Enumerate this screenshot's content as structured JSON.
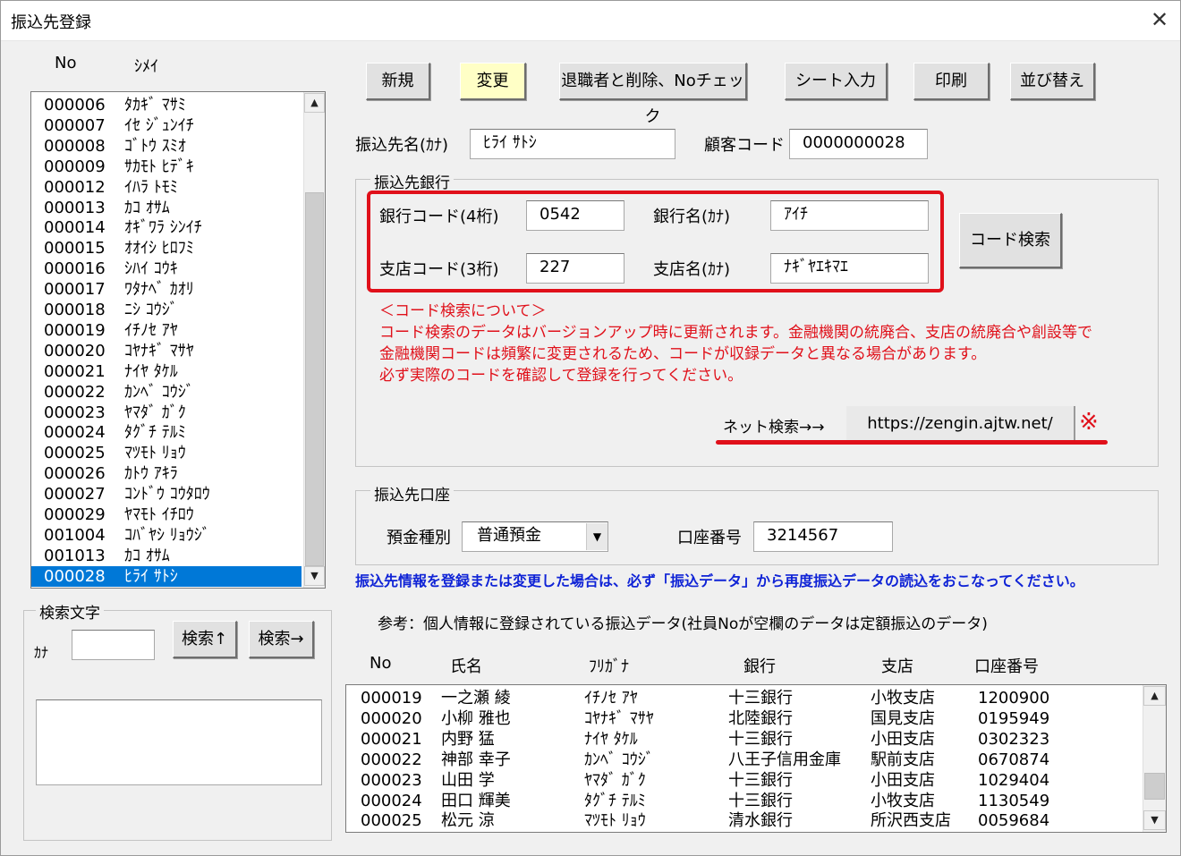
{
  "window": {
    "title": "振込先登録",
    "close_glyph": "✕"
  },
  "left_list": {
    "headers": {
      "no": "No",
      "name": "ｼﾒｲ"
    },
    "rows": [
      {
        "no": "000006",
        "name": "ﾀｶｷﾞ ﾏｻﾐ"
      },
      {
        "no": "000007",
        "name": "ｲｾ ｼﾞｭﾝｲﾁ"
      },
      {
        "no": "000008",
        "name": "ｺﾞﾄｳ ｽﾐｵ"
      },
      {
        "no": "000009",
        "name": "ｻｶﾓﾄ ﾋﾃﾞｷ"
      },
      {
        "no": "000012",
        "name": "ｲﾊﾗ ﾄﾓﾐ"
      },
      {
        "no": "000013",
        "name": "ｶｺ ｵｻﾑ"
      },
      {
        "no": "000014",
        "name": "ｵｷﾞﾜﾗ ｼﾝｲﾁ"
      },
      {
        "no": "000015",
        "name": "ｵｵｲｼ ﾋﾛﾌﾐ"
      },
      {
        "no": "000016",
        "name": "ｼﾊｲ ｺｳｷ"
      },
      {
        "no": "000017",
        "name": "ﾜﾀﾅﾍﾞ ｶｵﾘ"
      },
      {
        "no": "000018",
        "name": "ﾆｼ ｺｳｼﾞ"
      },
      {
        "no": "000019",
        "name": "ｲﾁﾉｾ ｱﾔ"
      },
      {
        "no": "000020",
        "name": "ｺﾔﾅｷﾞ ﾏｻﾔ"
      },
      {
        "no": "000021",
        "name": "ﾅｲﾔ ﾀｹﾙ"
      },
      {
        "no": "000022",
        "name": "ｶﾝﾍﾞ ｺｳｼﾞ"
      },
      {
        "no": "000023",
        "name": "ﾔﾏﾀﾞ ｶﾞｸ"
      },
      {
        "no": "000024",
        "name": "ﾀｸﾞﾁ ﾃﾙﾐ"
      },
      {
        "no": "000025",
        "name": "ﾏﾂﾓﾄ ﾘｮｳ"
      },
      {
        "no": "000026",
        "name": "ｶﾄｳ ｱｷﾗ"
      },
      {
        "no": "000027",
        "name": "ｺﾝﾄﾞｳ ｺｳﾀﾛｳ"
      },
      {
        "no": "000029",
        "name": "ﾔﾏﾓﾄ ｲﾁﾛｳ"
      },
      {
        "no": "001004",
        "name": "ｺﾊﾞﾔｼ ﾘｮｳｼﾞ"
      },
      {
        "no": "001013",
        "name": "ｶｺ ｵｻﾑ"
      },
      {
        "no": "000028",
        "name": "ﾋﾗｲ ｻﾄｼ"
      }
    ],
    "selected_index": 23
  },
  "search": {
    "group_title": "検索文字",
    "kana_label": "ｶﾅ",
    "kana_value": "",
    "btn_up": "検索↑",
    "btn_next": "検索→",
    "result_text": ""
  },
  "toolbar": {
    "new": "新規",
    "change": "変更",
    "retire_delete": "退職者と削除、Noチェック",
    "sheet_input": "シート入力",
    "print": "印刷",
    "sort": "並び替え"
  },
  "recipient": {
    "name_kana_label": "振込先名(ｶﾅ)",
    "name_kana_value": "ﾋﾗｲ ｻﾄｼ",
    "customer_code_label": "顧客コード",
    "customer_code_value": "0000000028"
  },
  "bank": {
    "group_title": "振込先銀行",
    "bank_code_label": "銀行コード(4桁)",
    "bank_code_value": "0542",
    "bank_name_label": "銀行名(ｶﾅ)",
    "bank_name_value": "ｱｲﾁ",
    "branch_code_label": "支店コード(3桁)",
    "branch_code_value": "227",
    "branch_name_label": "支店名(ｶﾅ)",
    "branch_name_value": "ﾅｷﾞﾔｴｷﾏｴ",
    "code_search_button": "コード検索",
    "notice_lines": [
      "＜コード検索について＞",
      "コード検索のデータはバージョンアップ時に更新されます。金融機関の統廃合、支店の統廃合や創設等で",
      "金融機関コードは頻繁に変更されるため、コードが収録データと異なる場合があります。",
      "必ず実際のコードを確認して登録を行ってください。"
    ],
    "net_search_label": "ネット検索→→",
    "net_search_url": "https://zengin.ajtw.net/",
    "note_mark": "※",
    "highlight_color": "#e0101a"
  },
  "account": {
    "group_title": "振込先口座",
    "type_label": "預金種別",
    "type_value": "普通預金",
    "number_label": "口座番号",
    "number_value": "3214567"
  },
  "notice_blue": "振込先情報を登録または変更した場合は、必ず「振込データ」から再度振込データの読込をおこなってください。",
  "reference": {
    "caption": "参考：個人情報に登録されている振込データ(社員Noが空欄のデータは定額振込のデータ)",
    "headers": {
      "no": "No",
      "name": "氏名",
      "kana": "ﾌﾘｶﾞﾅ",
      "bank": "銀行",
      "branch": "支店",
      "account": "口座番号"
    },
    "rows": [
      {
        "no": "000019",
        "name": "一之瀬 綾",
        "kana": "ｲﾁﾉｾ ｱﾔ",
        "bank": "十三銀行",
        "branch": "小牧支店",
        "account": "1200900"
      },
      {
        "no": "000020",
        "name": "小柳 雅也",
        "kana": "ｺﾔﾅｷﾞ ﾏｻﾔ",
        "bank": "北陸銀行",
        "branch": "国見支店",
        "account": "0195949"
      },
      {
        "no": "000021",
        "name": "内野 猛",
        "kana": "ﾅｲﾔ ﾀｹﾙ",
        "bank": "十三銀行",
        "branch": "小田支店",
        "account": "0302323"
      },
      {
        "no": "000022",
        "name": "神部 幸子",
        "kana": "ｶﾝﾍﾞ ｺｳｼﾞ",
        "bank": "八王子信用金庫",
        "branch": "駅前支店",
        "account": "0670874"
      },
      {
        "no": "000023",
        "name": "山田 学",
        "kana": "ﾔﾏﾀﾞ ｶﾞｸ",
        "bank": "十三銀行",
        "branch": "小田支店",
        "account": "1029404"
      },
      {
        "no": "000024",
        "name": "田口 輝美",
        "kana": "ﾀｸﾞﾁ ﾃﾙﾐ",
        "bank": "十三銀行",
        "branch": "小牧支店",
        "account": "1130549"
      },
      {
        "no": "000025",
        "name": "松元 涼",
        "kana": "ﾏﾂﾓﾄ ﾘｮｳ",
        "bank": "清水銀行",
        "branch": "所沢西支店",
        "account": "0059684"
      }
    ]
  },
  "icons": {
    "scroll_up": "▲",
    "scroll_down": "▼",
    "dropdown": "▼"
  }
}
